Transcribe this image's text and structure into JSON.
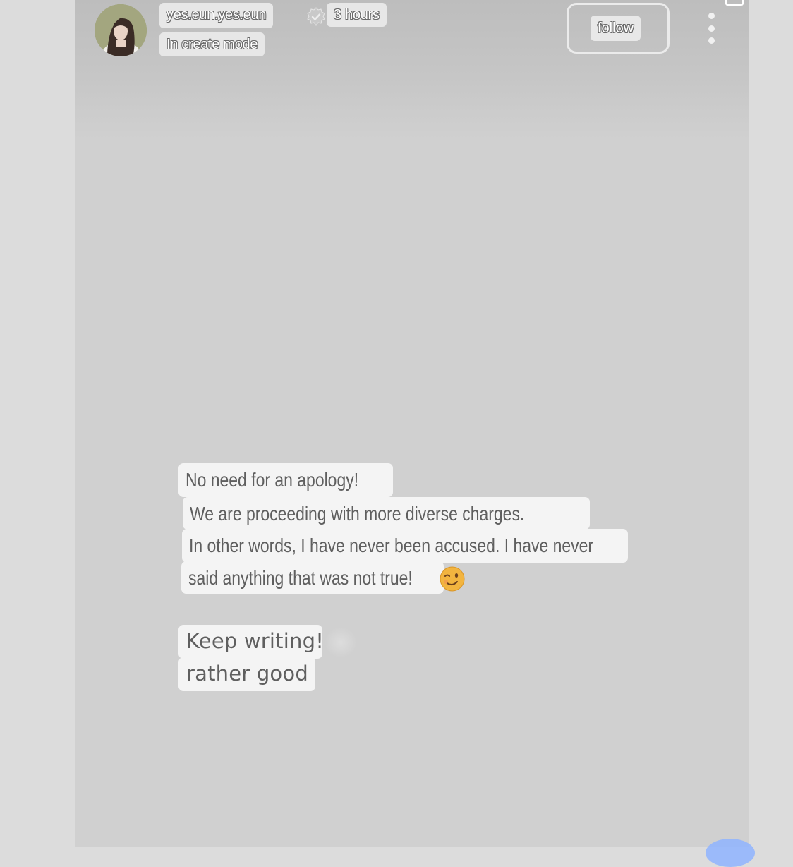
{
  "header": {
    "username": "yes.eun.yes.eun",
    "mode_label": "In create mode",
    "time_ago": "3 hours",
    "follow_label": "follow"
  },
  "icons": {
    "avatar": "avatar",
    "verified": "verified-badge-icon",
    "more": "more-vertical-icon",
    "emoji": "winking-face-emoji"
  },
  "message": {
    "lines": [
      "No need for an apology!",
      "We are proceeding with more diverse charges.",
      "In other words, I have never been accused. I have never",
      "said anything that was not true!"
    ],
    "closing": [
      "Keep writing!",
      "rather good"
    ]
  },
  "colors": {
    "background": "#d0d0d0",
    "text_highlight": "#f4f4f4",
    "text": "#5f5f5f",
    "fab": "#8fb4ff"
  }
}
